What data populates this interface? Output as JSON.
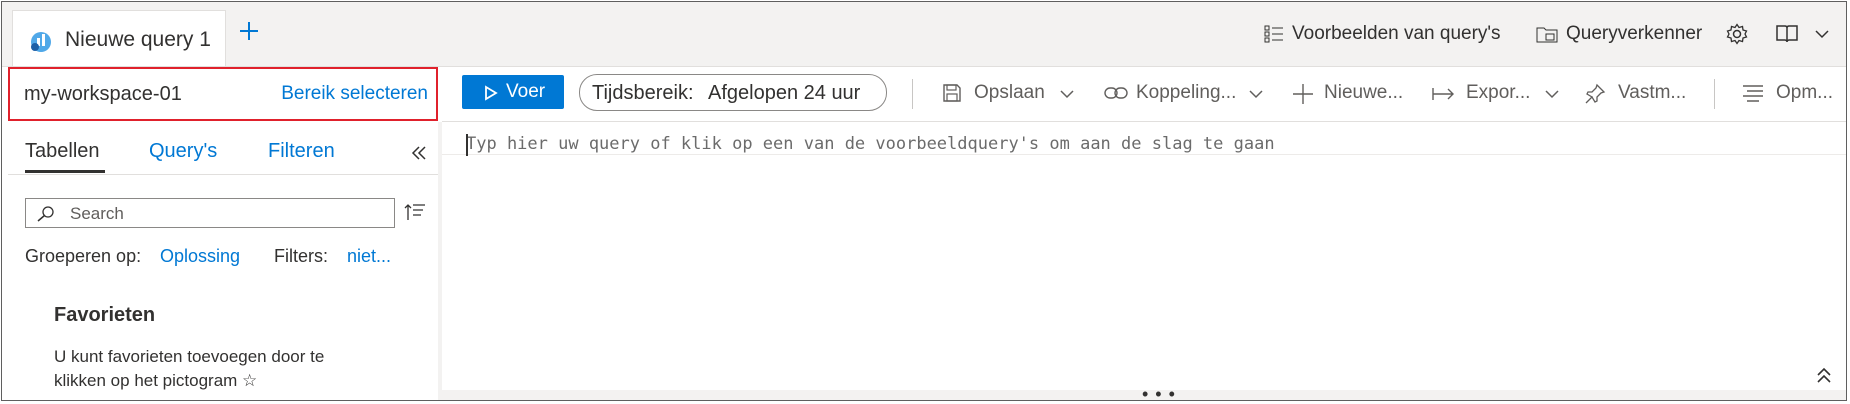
{
  "tabs": [
    {
      "label": "Nieuwe query 1"
    }
  ],
  "header": {
    "examples_label": "Voorbeelden van query's",
    "explorer_label": "Queryverkenner"
  },
  "scope": {
    "workspace": "my-workspace-01",
    "select_label": "Bereik selecteren"
  },
  "left_panel": {
    "tabs": [
      "Tabellen",
      "Query's",
      "Filteren"
    ],
    "search_placeholder": "Search",
    "group_label": "Groeperen op:",
    "group_value": "Oplossing",
    "filters_label": "Filters:",
    "filters_value": "niet...",
    "favorites_title": "Favorieten",
    "favorites_text": "U kunt favorieten toevoegen door te klikken op het pictogram ☆"
  },
  "toolbar": {
    "run_label": "Voer",
    "time_label": "Tijdsbereik:",
    "time_value": "Afgelopen 24 uur",
    "save_label": "Opslaan",
    "link_label": "Koppeling...",
    "new_label": "Nieuwe...",
    "export_label": "Expor...",
    "pin_label": "Vastm...",
    "format_label": "Opm..."
  },
  "editor": {
    "placeholder": "Typ hier uw query of klik op een van de voorbeeldquery's om aan de slag te gaan"
  },
  "colors": {
    "accent": "#0078d4",
    "highlight_border": "#e0212c"
  }
}
